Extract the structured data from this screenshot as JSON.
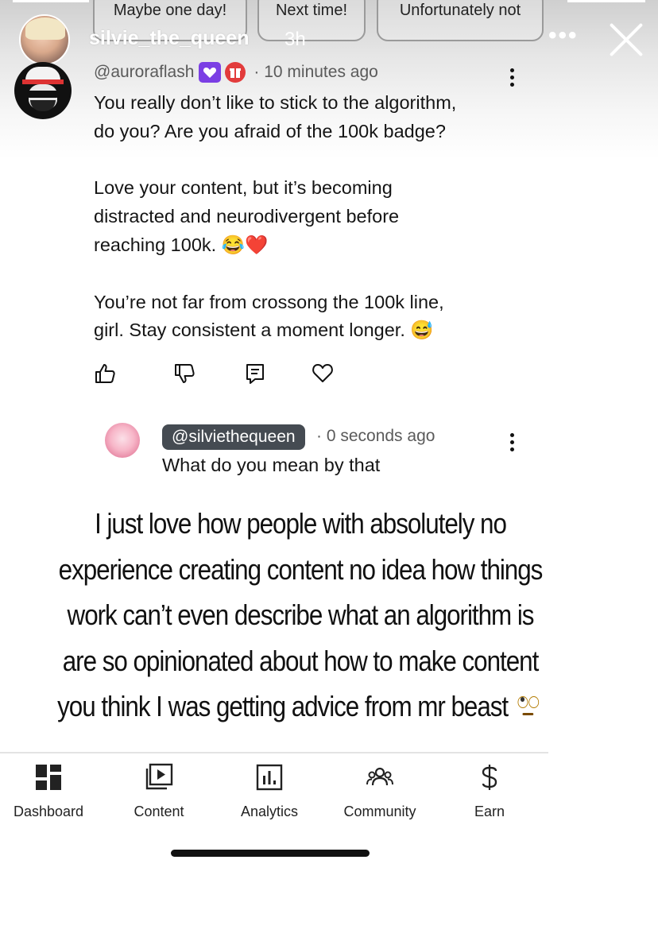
{
  "poll": {
    "options": [
      "Maybe one day!",
      "Next time!",
      "Unfortunately not"
    ]
  },
  "story": {
    "username": "silvie_the_queen",
    "time": "3h",
    "more_icon": "ellipsis-icon",
    "close_icon": "close-icon"
  },
  "comment": {
    "handle": "@auroraflash",
    "badges": [
      "heart-badge-icon",
      "gift-badge-icon"
    ],
    "time": "· 10 minutes ago",
    "paragraph1_line1": "You really don’t like to stick to the algorithm,",
    "paragraph1_line2": "do you? Are you afraid of the 100k badge?",
    "paragraph2_line1": "Love your content, but it’s becoming",
    "paragraph2_line2": "distracted and neurodivergent before",
    "paragraph2_line3": "reaching 100k. 😂❤️",
    "paragraph3_line1": "You’re not far from crossong the 100k line,",
    "paragraph3_line2": "girl. Stay consistent a moment longer. 😅",
    "actions": [
      "thumbs-up-icon",
      "thumbs-down-icon",
      "reply-icon",
      "heart-icon"
    ]
  },
  "reply": {
    "handle": "@silviethequeen",
    "time": "· 0 seconds ago",
    "text": "What do you mean by that"
  },
  "caption": {
    "line1": "I just love how people with absolutely no",
    "line2": "experience creating content no idea how things",
    "line3": "work can’t even describe what an algorithm is",
    "line4": "are so opinionated about how to make content",
    "line5": "you think I was getting advice from mr beast"
  },
  "nav": {
    "items": [
      {
        "label": "Dashboard",
        "icon": "dashboard-icon"
      },
      {
        "label": "Content",
        "icon": "content-icon"
      },
      {
        "label": "Analytics",
        "icon": "analytics-icon"
      },
      {
        "label": "Community",
        "icon": "community-icon"
      },
      {
        "label": "Earn",
        "icon": "earn-icon"
      }
    ]
  }
}
